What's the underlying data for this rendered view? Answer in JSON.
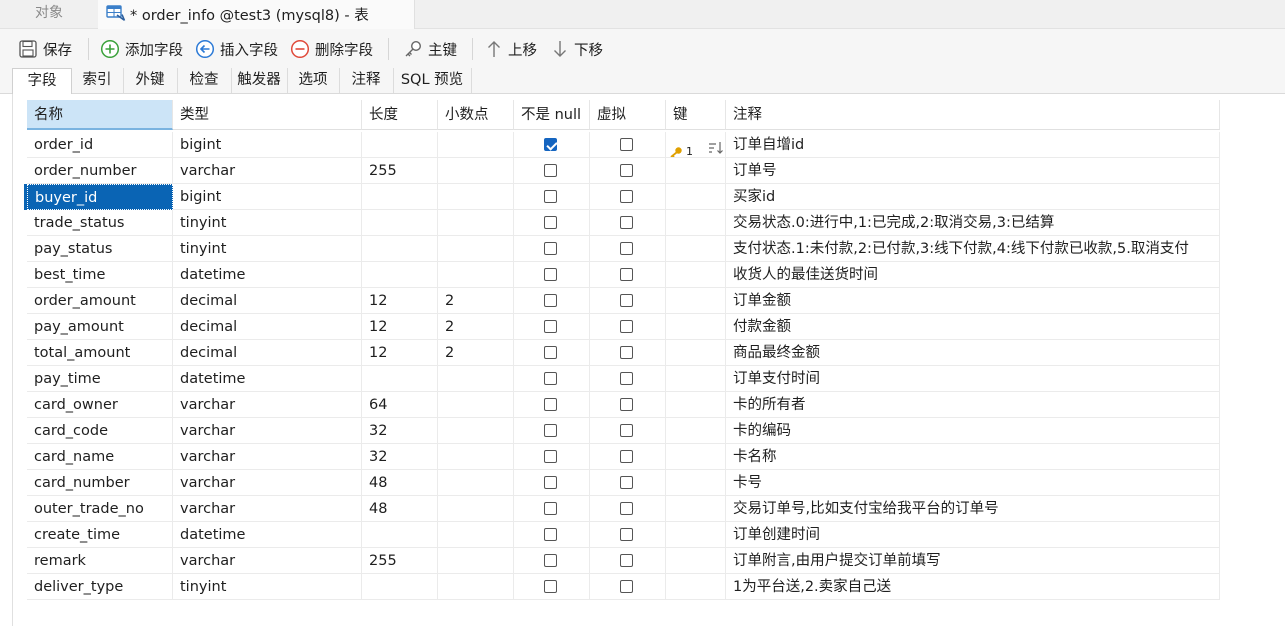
{
  "tabs": {
    "objects_label": "对象",
    "active_title": "* order_info @test3 (mysql8) - 表"
  },
  "toolbar": {
    "save": "保存",
    "add_field": "添加字段",
    "insert_field": "插入字段",
    "delete_field": "删除字段",
    "primary_key": "主键",
    "move_up": "上移",
    "move_down": "下移"
  },
  "subtabs": [
    "字段",
    "索引",
    "外键",
    "检查",
    "触发器",
    "选项",
    "注释",
    "SQL 预览"
  ],
  "columns": [
    "名称",
    "类型",
    "长度",
    "小数点",
    "不是 null",
    "虚拟",
    "键",
    "注释"
  ],
  "rows": [
    {
      "name": "order_id",
      "type": "bigint",
      "length": "",
      "decimals": "",
      "not_null": true,
      "virtual": false,
      "key": "1",
      "comment": "订单自增id"
    },
    {
      "name": "order_number",
      "type": "varchar",
      "length": "255",
      "decimals": "",
      "not_null": false,
      "virtual": false,
      "key": "",
      "comment": "订单号"
    },
    {
      "name": "buyer_id",
      "type": "bigint",
      "length": "",
      "decimals": "",
      "not_null": false,
      "virtual": false,
      "key": "",
      "comment": "买家id"
    },
    {
      "name": "trade_status",
      "type": "tinyint",
      "length": "",
      "decimals": "",
      "not_null": false,
      "virtual": false,
      "key": "",
      "comment": "交易状态.0:进行中,1:已完成,2:取消交易,3:已结算"
    },
    {
      "name": "pay_status",
      "type": "tinyint",
      "length": "",
      "decimals": "",
      "not_null": false,
      "virtual": false,
      "key": "",
      "comment": "支付状态.1:未付款,2:已付款,3:线下付款,4:线下付款已收款,5.取消支付"
    },
    {
      "name": "best_time",
      "type": "datetime",
      "length": "",
      "decimals": "",
      "not_null": false,
      "virtual": false,
      "key": "",
      "comment": "收货人的最佳送货时间"
    },
    {
      "name": "order_amount",
      "type": "decimal",
      "length": "12",
      "decimals": "2",
      "not_null": false,
      "virtual": false,
      "key": "",
      "comment": "订单金额"
    },
    {
      "name": "pay_amount",
      "type": "decimal",
      "length": "12",
      "decimals": "2",
      "not_null": false,
      "virtual": false,
      "key": "",
      "comment": "付款金额"
    },
    {
      "name": "total_amount",
      "type": "decimal",
      "length": "12",
      "decimals": "2",
      "not_null": false,
      "virtual": false,
      "key": "",
      "comment": "商品最终金额"
    },
    {
      "name": "pay_time",
      "type": "datetime",
      "length": "",
      "decimals": "",
      "not_null": false,
      "virtual": false,
      "key": "",
      "comment": "订单支付时间"
    },
    {
      "name": "card_owner",
      "type": "varchar",
      "length": "64",
      "decimals": "",
      "not_null": false,
      "virtual": false,
      "key": "",
      "comment": "卡的所有者"
    },
    {
      "name": "card_code",
      "type": "varchar",
      "length": "32",
      "decimals": "",
      "not_null": false,
      "virtual": false,
      "key": "",
      "comment": "卡的编码"
    },
    {
      "name": "card_name",
      "type": "varchar",
      "length": "32",
      "decimals": "",
      "not_null": false,
      "virtual": false,
      "key": "",
      "comment": "卡名称"
    },
    {
      "name": "card_number",
      "type": "varchar",
      "length": "48",
      "decimals": "",
      "not_null": false,
      "virtual": false,
      "key": "",
      "comment": "卡号"
    },
    {
      "name": "outer_trade_no",
      "type": "varchar",
      "length": "48",
      "decimals": "",
      "not_null": false,
      "virtual": false,
      "key": "",
      "comment": "交易订单号,比如支付宝给我平台的订单号"
    },
    {
      "name": "create_time",
      "type": "datetime",
      "length": "",
      "decimals": "",
      "not_null": false,
      "virtual": false,
      "key": "",
      "comment": "订单创建时间"
    },
    {
      "name": "remark",
      "type": "varchar",
      "length": "255",
      "decimals": "",
      "not_null": false,
      "virtual": false,
      "key": "",
      "comment": "订单附言,由用户提交订单前填写"
    },
    {
      "name": "deliver_type",
      "type": "tinyint",
      "length": "",
      "decimals": "",
      "not_null": false,
      "virtual": false,
      "key": "",
      "comment": "1为平台送,2.卖家自己送"
    }
  ],
  "selected_row": 2,
  "colors": {
    "accent": "#0a64b4",
    "header_selected": "#cce4f7",
    "checkbox_checked": "#1565c0",
    "add_icon": "#3aa13a",
    "insert_icon": "#2c7ad6",
    "delete_icon": "#e04a3a",
    "key_icon": "#e0a000"
  },
  "icons": {
    "save": "floppy-icon",
    "add": "plus-circle-icon",
    "insert": "arrow-left-circle-icon",
    "delete": "minus-circle-icon",
    "primary_key": "key-icon",
    "move_up": "arrow-up-icon",
    "move_down": "arrow-down-icon",
    "tab": "table-icon",
    "key_cell": "key-icon",
    "sort": "sort-icon"
  }
}
